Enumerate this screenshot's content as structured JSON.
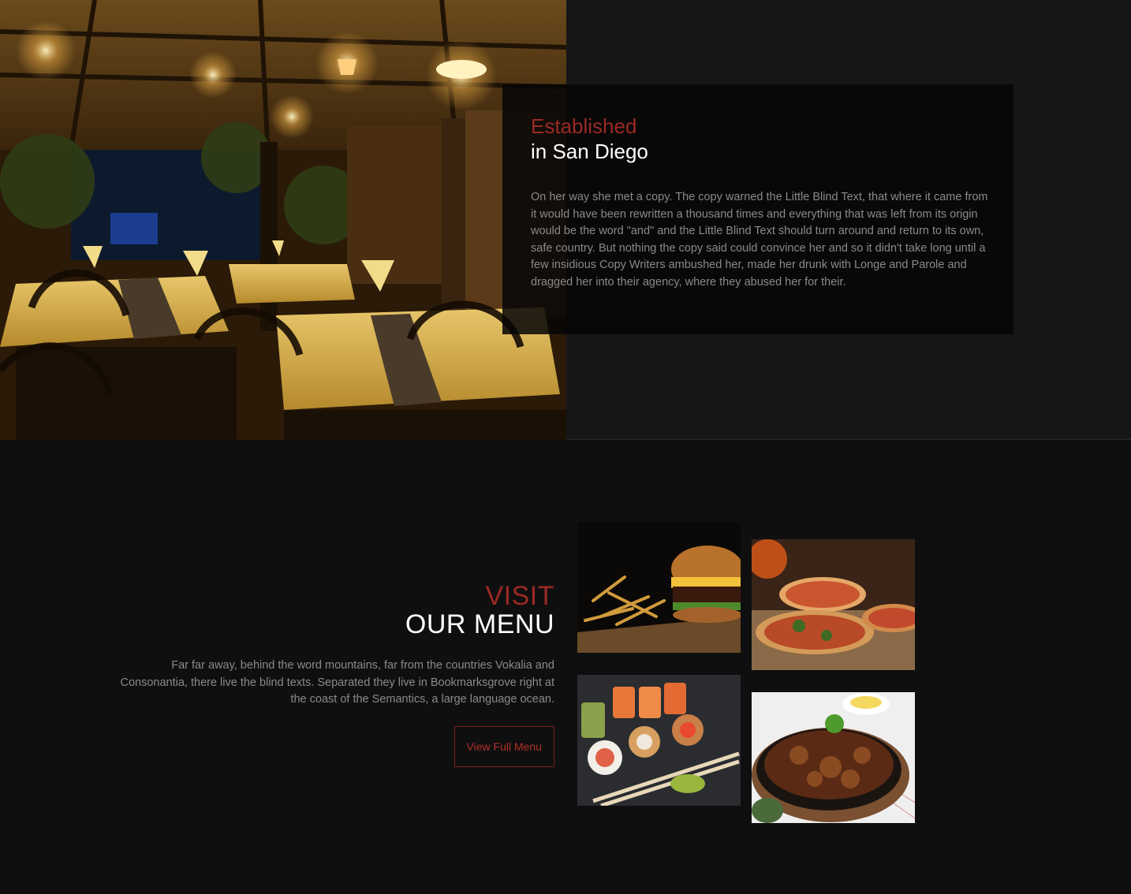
{
  "about": {
    "kicker": "Established",
    "title": "in San Diego",
    "text": "On her way she met a copy. The copy warned the Little Blind Text, that where it came from it would have been rewritten a thousand times and everything that was left from its origin would be the word \"and\" and the Little Blind Text should turn around and return to its own, safe country. But nothing the copy said could convince her and so it didn't take long until a few insidious Copy Writers ambushed her, made her drunk with Longe and Parole and dragged her into their agency, where they abused her for their."
  },
  "menu": {
    "kicker": "VISIT",
    "title": "OUR MENU",
    "text": "Far far away, behind the word mountains, far from the countries Vokalia and Consonantia, there live the blind texts. Separated they live in Bookmarksgrove right at the coast of the Semantics, a large language ocean.",
    "button_label": "View Full Menu",
    "dishes": [
      "burger-and-fries",
      "pizza",
      "sushi",
      "sizzling-beef"
    ]
  },
  "colors": {
    "accent": "#9a2a24",
    "page_bg": "#0f0f0f",
    "section_bg": "#161618",
    "card_bg": "#060606",
    "muted_text": "#8a8a8a"
  }
}
